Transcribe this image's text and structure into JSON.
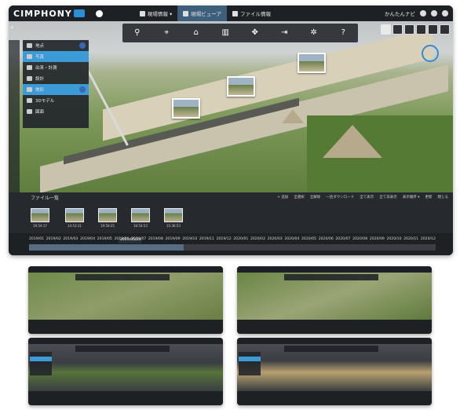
{
  "app": {
    "logo": "CIMPHONY",
    "tabs": [
      {
        "label": "現場情報 ▾",
        "icon": "location-pin-icon"
      },
      {
        "label": "現場ビューア",
        "icon": "home-icon",
        "active": true
      },
      {
        "label": "ファイル情報",
        "icon": "folder-icon"
      }
    ],
    "user": "かんたんナビ"
  },
  "side_panel": {
    "items": [
      {
        "label": "地点",
        "selected": false
      },
      {
        "label": "写真",
        "selected": true
      },
      {
        "label": "出来・計測",
        "selected": false
      },
      {
        "label": "設計",
        "selected": false
      },
      {
        "label": "地形",
        "selected": true
      },
      {
        "label": "3Dモデル",
        "selected": false
      },
      {
        "label": "図面",
        "selected": false
      }
    ]
  },
  "files": {
    "title": "ファイル一覧",
    "actions": [
      "+ 追加",
      "全選択",
      "全解除",
      "一括ダウンロード",
      "全て表示",
      "全て非表示",
      "表示順序 ▾",
      "更新",
      "閉じる"
    ],
    "thumbs": [
      {
        "label": "19:54:17"
      },
      {
        "label": "14:53:11"
      },
      {
        "label": "19:59:25"
      },
      {
        "label": "16:54:53"
      },
      {
        "label": "15:36:53"
      }
    ]
  },
  "timeline": {
    "selected_date": "2019/05/24",
    "months": [
      "2019/01",
      "2019/02",
      "2019/03",
      "2019/04",
      "2019/05",
      "2019/06",
      "2019/07",
      "2019/08",
      "2019/09",
      "2019/10",
      "2019/11",
      "2019/12",
      "2020/01",
      "2020/02",
      "2020/03",
      "2020/04",
      "2020/05",
      "2020/06",
      "2020/07",
      "2020/08",
      "2020/09",
      "2020/10",
      "2020/11",
      "2020/12"
    ],
    "selected_fraction": 0.38
  },
  "colors": {
    "accent": "#3c9bd6",
    "topbar": "#1d2125",
    "panel": "#22262a"
  }
}
